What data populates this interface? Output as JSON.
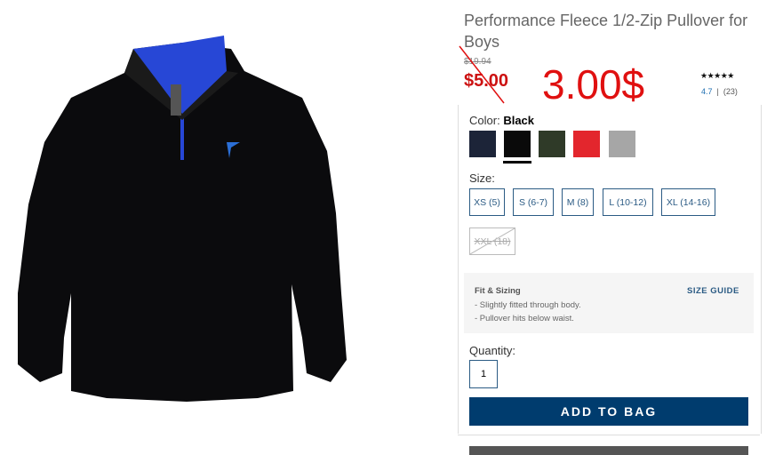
{
  "product": {
    "title": "Performance Fleece 1/2-Zip Pullover for Boys",
    "old_price": "$19.94",
    "sale_price": "$5.00",
    "annotation_price": "3.00$"
  },
  "rating": {
    "stars": "★★★★★",
    "value": "4.7",
    "count": "(23)"
  },
  "color": {
    "label": "Color:",
    "selected": "Black",
    "swatches": [
      {
        "name": "navy",
        "hex": "#1c2438"
      },
      {
        "name": "black",
        "hex": "#0a0a0a"
      },
      {
        "name": "olive",
        "hex": "#2f3a28"
      },
      {
        "name": "red",
        "hex": "#e3262d"
      },
      {
        "name": "heather-grey",
        "hex": "#a6a6a6"
      }
    ]
  },
  "size": {
    "label": "Size:",
    "options": [
      "XS (5)",
      "S (6-7)",
      "M (8)",
      "L (10-12)",
      "XL (14-16)",
      "XXL (18)"
    ]
  },
  "fit": {
    "title": "Fit & Sizing",
    "guide_label": "SIZE GUIDE",
    "notes": [
      "- Slightly fitted through body.",
      "- Pullover hits below waist."
    ]
  },
  "quantity": {
    "label": "Quantity:",
    "value": "1"
  },
  "cta": {
    "add_to_bag": "ADD TO BAG"
  },
  "colors": {
    "accent": "#003c6e",
    "sale": "#cc1111",
    "link": "#2b5b84"
  }
}
